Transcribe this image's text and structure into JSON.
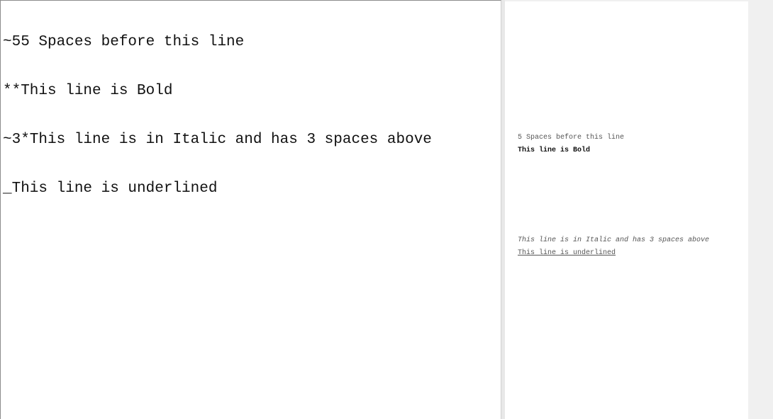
{
  "editor": {
    "lines": [
      "~55 Spaces before this line",
      "**This line is Bold",
      "~3*This line is in Italic and has 3 spaces above",
      "_This line is underlined"
    ]
  },
  "preview": {
    "lines": [
      "5 Spaces before this line",
      "This line is Bold",
      "This line is in Italic and has 3 spaces above",
      "This line is underlined"
    ]
  }
}
